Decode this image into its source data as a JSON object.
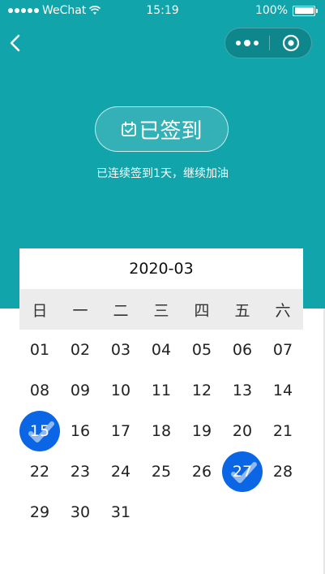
{
  "status_bar": {
    "carrier": "WeChat",
    "time": "15:19",
    "battery_text": "100%",
    "battery_level": 1.0
  },
  "nav": {
    "back_icon": "chevron-left-icon",
    "more_icon": "more-dots-icon",
    "close_icon": "target-circle-icon"
  },
  "signin": {
    "label": "已签到",
    "icon": "calendar-check-icon",
    "subtitle": "已连续签到1天，继续加油"
  },
  "calendar": {
    "month": "2020-03",
    "weekdays": [
      "日",
      "一",
      "二",
      "三",
      "四",
      "五",
      "六"
    ],
    "days": [
      "01",
      "02",
      "03",
      "04",
      "05",
      "06",
      "07",
      "08",
      "09",
      "10",
      "11",
      "12",
      "13",
      "14",
      "15",
      "16",
      "17",
      "18",
      "19",
      "20",
      "21",
      "22",
      "23",
      "24",
      "25",
      "26",
      "27",
      "28",
      "29",
      "30",
      "31"
    ],
    "signed_days": [
      "15",
      "27"
    ]
  },
  "colors": {
    "header_bg": "#11a4ab",
    "signed_bg": "#0b66e6",
    "weekday_bg": "#ececec"
  }
}
